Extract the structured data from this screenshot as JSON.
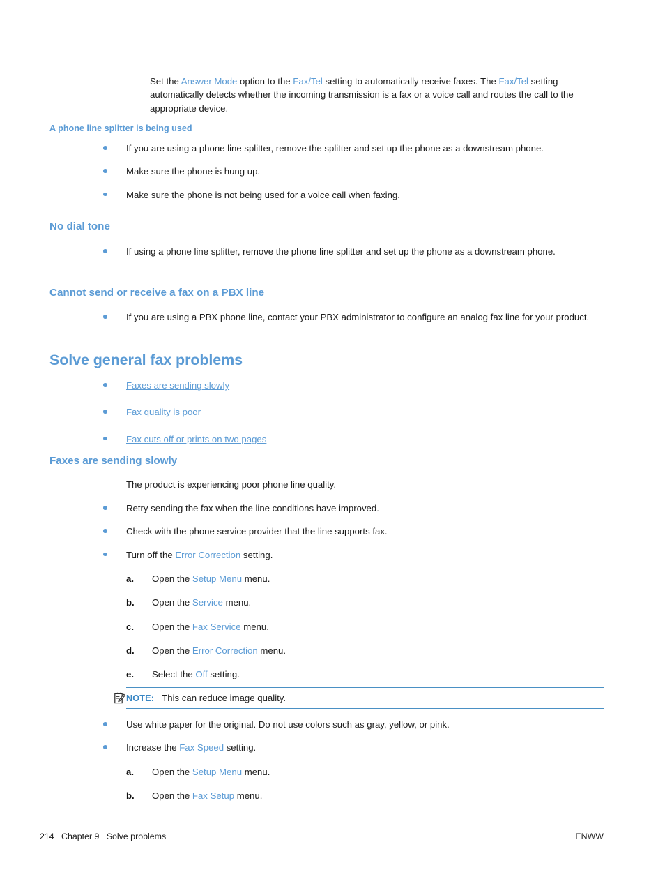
{
  "page": {
    "intro_paragraph": {
      "parts": [
        {
          "t": "Set the ",
          "hl": false
        },
        {
          "t": "Answer Mode",
          "hl": true
        },
        {
          "t": " option to the ",
          "hl": false
        },
        {
          "t": "Fax/Tel",
          "hl": true
        },
        {
          "t": " setting to automatically receive faxes. The ",
          "hl": false
        },
        {
          "t": "Fax/Tel",
          "hl": true
        },
        {
          "t": " setting automatically detects whether the incoming transmission is a fax or a voice call and routes the call to the appropriate device.",
          "hl": false
        }
      ]
    },
    "splitter_heading": "A phone line splitter is being used",
    "splitter_bullets": [
      "If you are using a phone line splitter, remove the splitter and set up the phone as a downstream phone.",
      "Make sure the phone is hung up.",
      "Make sure the phone is not being used for a voice call when faxing."
    ],
    "no_dial_tone_heading": "No dial tone",
    "no_dial_tone_bullets": [
      "If using a phone line splitter, remove the phone line splitter and set up the phone as a downstream phone."
    ],
    "pbx_heading": "Cannot send or receive a fax on a PBX line",
    "pbx_bullets": [
      "If you are using a PBX phone line, contact your PBX administrator to configure an analog fax line for your product."
    ],
    "solve_general_heading": "Solve general fax problems",
    "toc_links": [
      "Faxes are sending slowly",
      "Fax quality is poor",
      "Fax cuts off or prints on two pages"
    ],
    "slow_heading": "Faxes are sending slowly",
    "slow_intro": "The product is experiencing poor phone line quality.",
    "slow_bullets": [
      {
        "parts": [
          {
            "t": "Retry sending the fax when the line conditions have improved.",
            "hl": false
          }
        ]
      },
      {
        "parts": [
          {
            "t": "Check with the phone service provider that the line supports fax.",
            "hl": false
          }
        ]
      },
      {
        "parts": [
          {
            "t": "Turn off the ",
            "hl": false
          },
          {
            "t": "Error Correction",
            "hl": true
          },
          {
            "t": " setting.",
            "hl": false
          }
        ]
      }
    ],
    "error_correction_steps": [
      {
        "mark": "a.",
        "parts": [
          {
            "t": "Open the ",
            "hl": false
          },
          {
            "t": "Setup Menu",
            "hl": true
          },
          {
            "t": " menu.",
            "hl": false
          }
        ]
      },
      {
        "mark": "b.",
        "parts": [
          {
            "t": "Open the ",
            "hl": false
          },
          {
            "t": "Service",
            "hl": true
          },
          {
            "t": " menu.",
            "hl": false
          }
        ]
      },
      {
        "mark": "c.",
        "parts": [
          {
            "t": "Open the ",
            "hl": false
          },
          {
            "t": "Fax Service",
            "hl": true
          },
          {
            "t": " menu.",
            "hl": false
          }
        ]
      },
      {
        "mark": "d.",
        "parts": [
          {
            "t": "Open the ",
            "hl": false
          },
          {
            "t": "Error Correction",
            "hl": true
          },
          {
            "t": " menu.",
            "hl": false
          }
        ]
      },
      {
        "mark": "e.",
        "parts": [
          {
            "t": "Select the ",
            "hl": false
          },
          {
            "t": "Off",
            "hl": true
          },
          {
            "t": " setting.",
            "hl": false
          }
        ]
      }
    ],
    "note": {
      "icon": "note-pencil-icon",
      "label": "NOTE:",
      "text": "This can reduce image quality."
    },
    "after_note_bullets": [
      {
        "parts": [
          {
            "t": "Use white paper for the original. Do not use colors such as gray, yellow, or pink.",
            "hl": false
          }
        ]
      },
      {
        "parts": [
          {
            "t": "Increase the ",
            "hl": false
          },
          {
            "t": "Fax Speed",
            "hl": true
          },
          {
            "t": " setting.",
            "hl": false
          }
        ]
      }
    ],
    "fax_speed_steps": [
      {
        "mark": "a.",
        "parts": [
          {
            "t": "Open the ",
            "hl": false
          },
          {
            "t": "Setup Menu",
            "hl": true
          },
          {
            "t": " menu.",
            "hl": false
          }
        ]
      },
      {
        "mark": "b.",
        "parts": [
          {
            "t": "Open the ",
            "hl": false
          },
          {
            "t": "Fax Setup",
            "hl": true
          },
          {
            "t": " menu.",
            "hl": false
          }
        ]
      }
    ],
    "footer": {
      "left": "214   Chapter 9   Solve problems",
      "right": "ENWW"
    },
    "colors": {
      "heading_blue": "#5b9bd5",
      "link_blue": "#5b9bd5",
      "note_rule": "#4a90c4",
      "body_text": "#1c1c1c"
    }
  }
}
